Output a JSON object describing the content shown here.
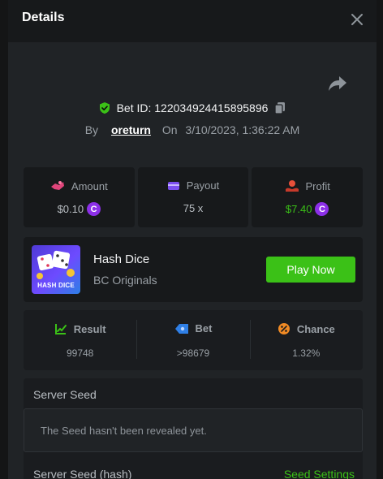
{
  "header": {
    "title": "Details",
    "close_icon": "close-icon"
  },
  "share_icon": "share-icon",
  "bet": {
    "id_text": "Bet ID: 122034924415895896",
    "verified_icon": "shield-check-icon",
    "copy_icon": "copy-icon",
    "by_label": "By",
    "username": "oreturn",
    "on_label": "On",
    "datetime": "3/10/2023, 1:36:22 AM"
  },
  "stats": {
    "amount": {
      "label": "Amount",
      "value": "$0.10",
      "icon": "amount-icon"
    },
    "payout": {
      "label": "Payout",
      "value": "75 x",
      "icon": "payout-icon"
    },
    "profit": {
      "label": "Profit",
      "value": "$7.40",
      "icon": "profit-icon"
    },
    "coin_icon": "coin-icon",
    "coin_glyph": "C"
  },
  "game": {
    "name": "Hash Dice",
    "provider": "BC Originals",
    "thumb_label": "HASH DICE",
    "play_label": "Play Now"
  },
  "result": {
    "result_label": "Result",
    "result_value": "99748",
    "bet_label": "Bet",
    "bet_value": ">98679",
    "chance_label": "Chance",
    "chance_value": "1.32%"
  },
  "seeds": {
    "server_seed_title": "Server Seed",
    "server_seed_placeholder": "The Seed hasn't been revealed yet.",
    "server_seed_hash_title": "Server Seed (hash)",
    "seed_settings_label": "Seed Settings"
  },
  "colors": {
    "accent_green": "#3bc117",
    "coin_purple": "#8c2fe8",
    "panel_bg": "#202326",
    "header_bg": "#17191b"
  }
}
